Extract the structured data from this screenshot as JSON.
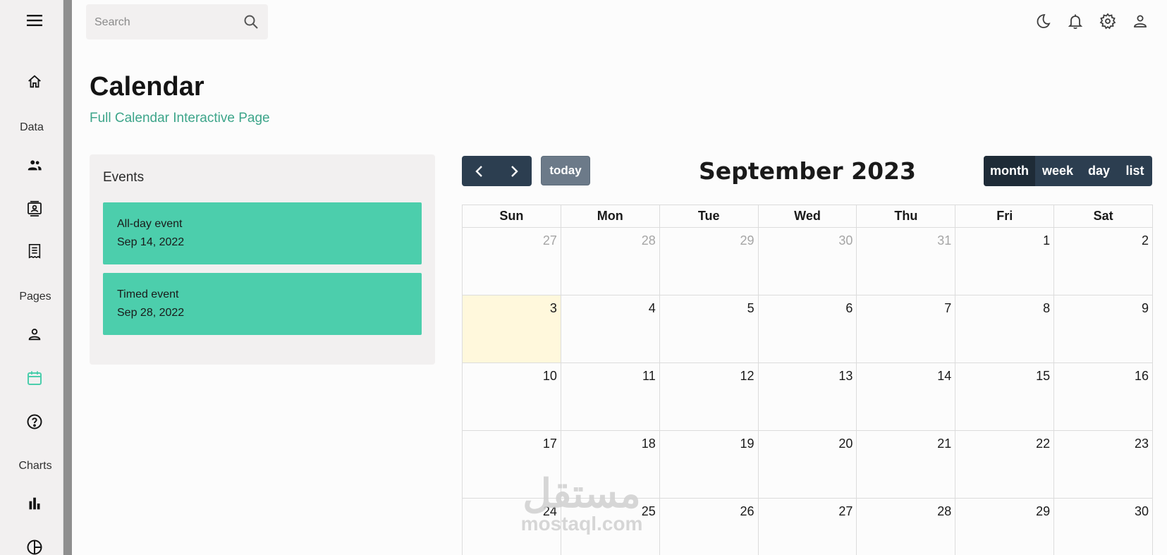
{
  "search": {
    "placeholder": "Search"
  },
  "sidebar": {
    "headings": {
      "data": "Data",
      "pages": "Pages",
      "charts": "Charts"
    },
    "icons": [
      "menu-icon",
      "home-icon",
      "team-icon",
      "contacts-icon",
      "invoices-icon",
      "profile-icon",
      "calendar-icon",
      "faq-icon",
      "bar-chart-icon",
      "pie-chart-icon"
    ],
    "active_item": "calendar",
    "active_color": "#4cceac"
  },
  "topbar": {
    "icons": [
      "dark-mode-icon",
      "notifications-icon",
      "settings-icon",
      "person-icon"
    ]
  },
  "header": {
    "title": "Calendar",
    "subtitle": "Full Calendar Interactive Page"
  },
  "events": {
    "title": "Events",
    "items": [
      {
        "title": "All-day event",
        "date": "Sep 14, 2022"
      },
      {
        "title": "Timed event",
        "date": "Sep 28, 2022"
      }
    ],
    "card_color": "#4cceac"
  },
  "calendar": {
    "title": "September 2023",
    "today_label": "today",
    "views": [
      "month",
      "week",
      "day",
      "list"
    ],
    "active_view": "month",
    "weekdays": [
      "Sun",
      "Mon",
      "Tue",
      "Wed",
      "Thu",
      "Fri",
      "Sat"
    ],
    "weeks": [
      [
        "27",
        "28",
        "29",
        "30",
        "31",
        "1",
        "2"
      ],
      [
        "3",
        "4",
        "5",
        "6",
        "7",
        "8",
        "9"
      ],
      [
        "10",
        "11",
        "12",
        "13",
        "14",
        "15",
        "16"
      ],
      [
        "17",
        "18",
        "19",
        "20",
        "21",
        "22",
        "23"
      ],
      [
        "24",
        "25",
        "26",
        "27",
        "28",
        "29",
        "30"
      ]
    ],
    "today_highlight_color": "#fff8dc"
  },
  "watermark": {
    "arabic": "مستقل",
    "latin": "mostaql.com"
  }
}
